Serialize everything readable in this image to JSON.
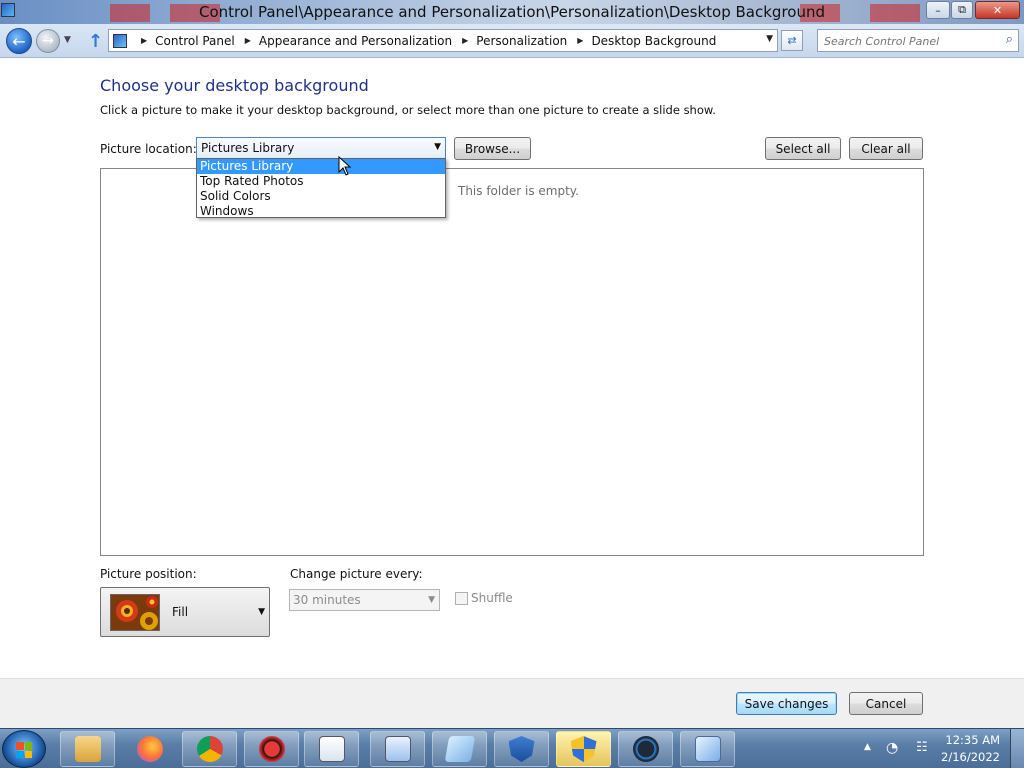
{
  "window": {
    "title": "Control Panel\\Appearance and Personalization\\Personalization\\Desktop Background"
  },
  "address": {
    "crumbs": [
      "Control Panel",
      "Appearance and Personalization",
      "Personalization",
      "Desktop Background"
    ],
    "search_placeholder": "Search Control Panel"
  },
  "page": {
    "heading": "Choose your desktop background",
    "subtext": "Click a picture to make it your desktop background, or select more than one picture to create a slide show.",
    "location_label": "Picture location:",
    "location_value": "Pictures Library",
    "location_options": [
      "Pictures Library",
      "Top Rated Photos",
      "Solid Colors",
      "Windows"
    ],
    "browse_label": "Browse...",
    "select_all_label": "Select all",
    "clear_all_label": "Clear all",
    "empty_text": "This folder is empty.",
    "position_label": "Picture position:",
    "position_value": "Fill",
    "change_every_label": "Change picture every:",
    "change_every_value": "30 minutes",
    "shuffle_label": "Shuffle",
    "shuffle_checked": false
  },
  "footer": {
    "save_label": "Save changes",
    "cancel_label": "Cancel"
  },
  "taskbar": {
    "apps": [
      "explorer-icon",
      "firefox-icon",
      "chrome-icon",
      "app-red-icon",
      "notepad-icon",
      "wordpad-icon",
      "paint-icon",
      "shield-blue-icon",
      "uac-shield-icon",
      "ccleaner-icon",
      "control-panel-icon"
    ],
    "time": "12:35 AM",
    "date": "2/16/2022"
  },
  "colors": {
    "heading": "#1e3287",
    "selection": "#3399ff",
    "taskbar": "#5a7ea8"
  }
}
